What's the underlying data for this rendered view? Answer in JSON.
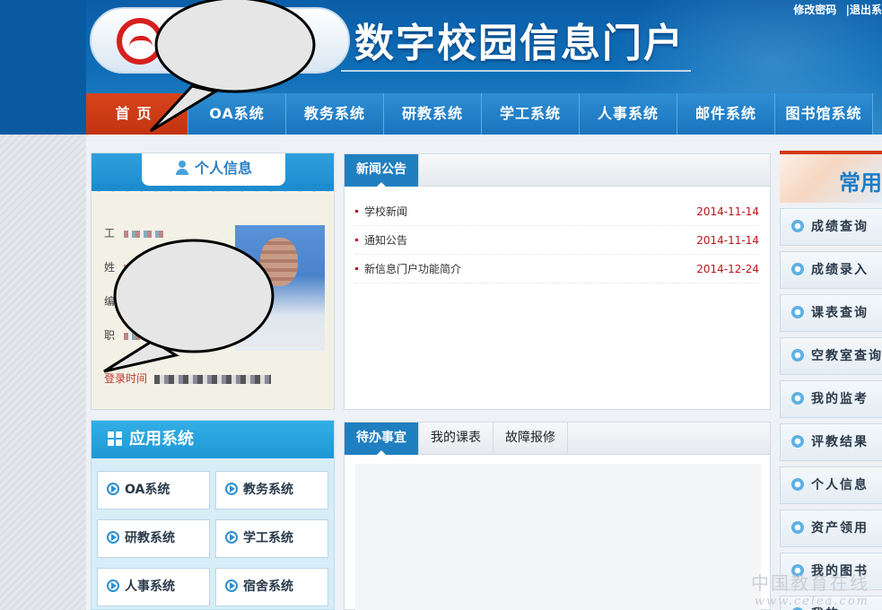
{
  "header": {
    "site_title": "数字校园信息门户",
    "change_password": "修改密码",
    "logout": "|退出系"
  },
  "nav": [
    "首页",
    "OA系统",
    "教务系统",
    "研教系统",
    "学工系统",
    "人事系统",
    "邮件系统",
    "图书馆系统"
  ],
  "personal": {
    "title": "个人信息",
    "fields": [
      "工",
      "姓",
      "编",
      "职"
    ],
    "login_label": "登录时间"
  },
  "apps": {
    "title": "应用系统",
    "items": [
      "OA系统",
      "教务系统",
      "研教系统",
      "学工系统",
      "人事系统",
      "宿舍系统"
    ]
  },
  "news": {
    "tab": "新闻公告",
    "items": [
      {
        "title": "学校新闻",
        "date": "2014-11-14"
      },
      {
        "title": "通知公告",
        "date": "2014-11-14"
      },
      {
        "title": "新信息门户功能简介",
        "date": "2014-12-24"
      }
    ]
  },
  "todo": {
    "tabs": [
      "待办事宜",
      "我的课表",
      "故障报修"
    ]
  },
  "quick": {
    "banner": "常用",
    "items": [
      "成绩查询",
      "成绩录入",
      "课表查询",
      "空教室查询",
      "我的监考",
      "评教结果",
      "个人信息",
      "资产领用",
      "我的图书",
      "我的"
    ]
  },
  "watermark": {
    "cn": "中国教育在线",
    "url": "www.celea.com"
  },
  "colors": {
    "header_blue": "#0f6fb8",
    "nav_active": "#c23310",
    "date_red": "#b9151b"
  }
}
